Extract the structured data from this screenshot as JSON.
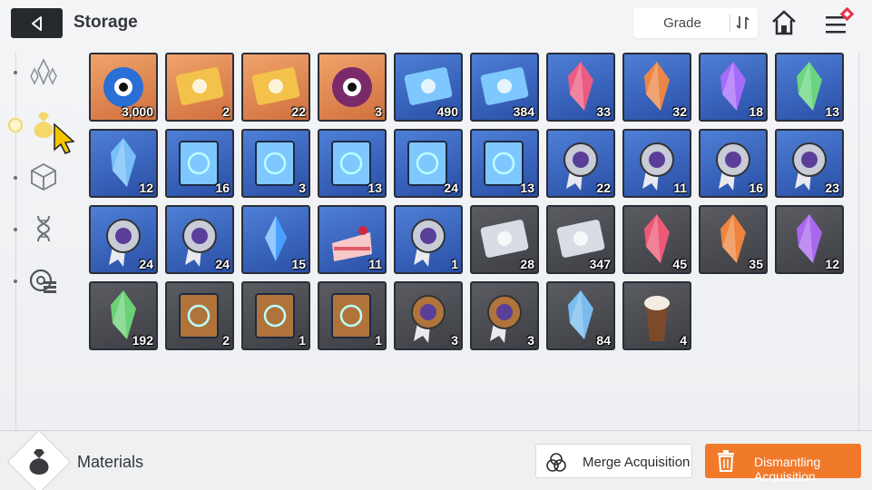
{
  "header": {
    "title": "Storage",
    "grade_label": "Grade"
  },
  "sidebar": {
    "items": [
      {
        "icon": "crystal-icon",
        "active": false
      },
      {
        "icon": "materials-bag-icon",
        "active": true
      },
      {
        "icon": "cube-icon",
        "active": false
      },
      {
        "icon": "dna-icon",
        "active": false
      },
      {
        "icon": "gear-list-icon",
        "active": false
      }
    ]
  },
  "items": [
    {
      "icon": "blue-eye-creature-icon",
      "count": "3,000",
      "rarity": "orange"
    },
    {
      "icon": "gold-ticket-icon",
      "count": "2",
      "rarity": "orange"
    },
    {
      "icon": "gold-compass-ticket-icon",
      "count": "22",
      "rarity": "orange"
    },
    {
      "icon": "purple-eye-orb-icon",
      "count": "3",
      "rarity": "orange"
    },
    {
      "icon": "blue-ticket-icon",
      "count": "490",
      "rarity": "blue"
    },
    {
      "icon": "blue-compass-ticket-icon",
      "count": "384",
      "rarity": "blue"
    },
    {
      "icon": "red-crystal-icon",
      "count": "33",
      "rarity": "blue"
    },
    {
      "icon": "orange-crystal-icon",
      "count": "32",
      "rarity": "blue"
    },
    {
      "icon": "purple-crystal-icon",
      "count": "18",
      "rarity": "blue"
    },
    {
      "icon": "green-crystal-icon",
      "count": "13",
      "rarity": "blue"
    },
    {
      "icon": "blue-crystal-icon",
      "count": "12",
      "rarity": "blue"
    },
    {
      "icon": "blue-sword-book-icon",
      "count": "16",
      "rarity": "blue"
    },
    {
      "icon": "blue-shield-book-icon",
      "count": "3",
      "rarity": "blue"
    },
    {
      "icon": "blue-wing-book-icon",
      "count": "13",
      "rarity": "blue"
    },
    {
      "icon": "blue-ring-book-icon",
      "count": "24",
      "rarity": "blue"
    },
    {
      "icon": "blue-cross-book-icon",
      "count": "13",
      "rarity": "blue"
    },
    {
      "icon": "cross-medal-icon",
      "count": "22",
      "rarity": "blue"
    },
    {
      "icon": "triangle-medal-icon",
      "count": "11",
      "rarity": "blue"
    },
    {
      "icon": "eye-medal-icon",
      "count": "16",
      "rarity": "blue"
    },
    {
      "icon": "star-medal-icon",
      "count": "23",
      "rarity": "blue"
    },
    {
      "icon": "lightning-medal-icon",
      "count": "24",
      "rarity": "blue"
    },
    {
      "icon": "target-medal-icon",
      "count": "24",
      "rarity": "blue"
    },
    {
      "icon": "ice-shard-icon",
      "count": "15",
      "rarity": "blue"
    },
    {
      "icon": "cake-icon",
      "count": "11",
      "rarity": "blue"
    },
    {
      "icon": "star-badge-icon",
      "count": "1",
      "rarity": "blue"
    },
    {
      "icon": "silver-ticket-icon",
      "count": "28",
      "rarity": "gray"
    },
    {
      "icon": "silver-compass-ticket-icon",
      "count": "347",
      "rarity": "gray"
    },
    {
      "icon": "red-crystal-small-icon",
      "count": "45",
      "rarity": "gray"
    },
    {
      "icon": "orange-crystal-small-icon",
      "count": "35",
      "rarity": "gray"
    },
    {
      "icon": "purple-crystal-small-icon",
      "count": "12",
      "rarity": "gray"
    },
    {
      "icon": "green-crystal-small-icon",
      "count": "192",
      "rarity": "gray"
    },
    {
      "icon": "bronze-shield-book-icon",
      "count": "2",
      "rarity": "gray"
    },
    {
      "icon": "bronze-wing-book-icon",
      "count": "1",
      "rarity": "gray"
    },
    {
      "icon": "bronze-cross-book-icon",
      "count": "1",
      "rarity": "gray"
    },
    {
      "icon": "bronze-lightning-medal-icon",
      "count": "3",
      "rarity": "gray"
    },
    {
      "icon": "bronze-target-medal-icon",
      "count": "3",
      "rarity": "gray"
    },
    {
      "icon": "blue-gem-cluster-icon",
      "count": "84",
      "rarity": "gray"
    },
    {
      "icon": "coffee-frappe-icon",
      "count": "4",
      "rarity": "gray"
    }
  ],
  "footer": {
    "category_label": "Materials",
    "merge_label": "Merge Acquisition",
    "dismantle_label": "Dismantling Acquisition"
  },
  "colors": {
    "accent_orange": "#f07a2a",
    "rarity_orange": "#e08a52",
    "rarity_blue": "#3a62bd",
    "rarity_gray": "#4a4c52"
  }
}
